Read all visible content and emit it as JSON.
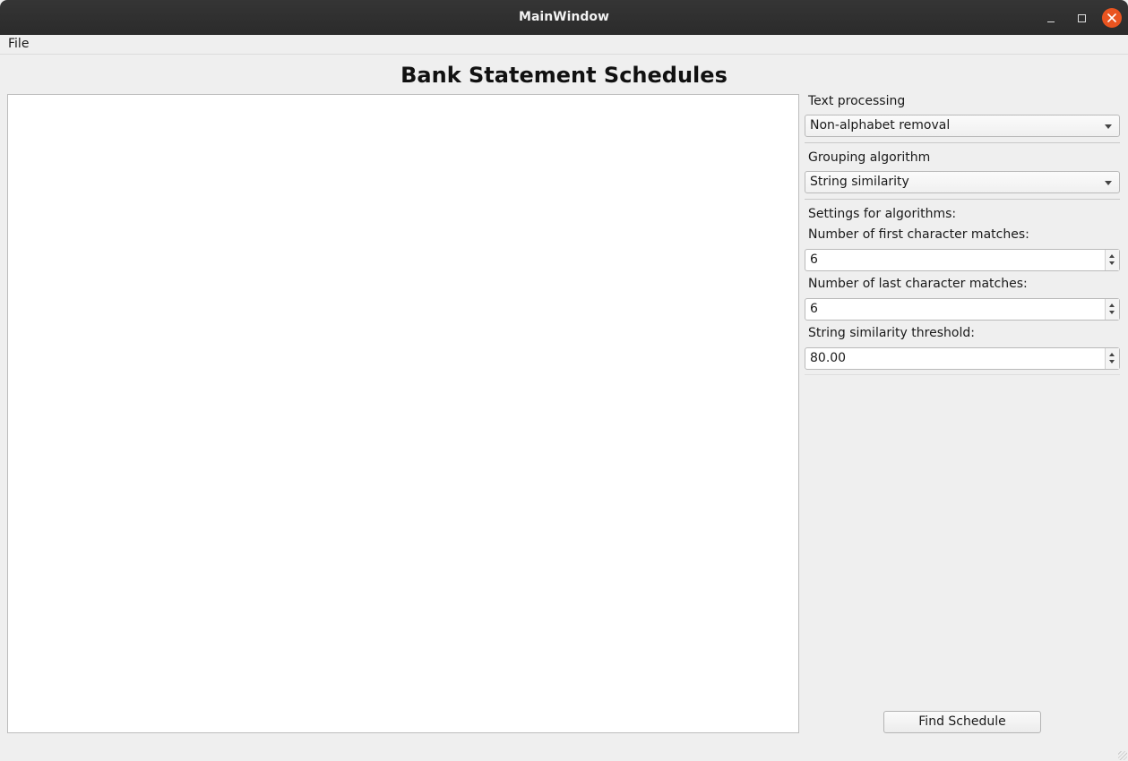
{
  "window": {
    "title": "MainWindow",
    "controls": [
      "minimize-icon",
      "maximize-icon",
      "close-icon"
    ],
    "close_color": "#e95420"
  },
  "menubar": {
    "items": [
      {
        "label": "File"
      }
    ]
  },
  "heading": "Bank Statement Schedules",
  "controls": {
    "text_processing": {
      "label": "Text processing",
      "value": "Non-alphabet removal"
    },
    "grouping_algorithm": {
      "label": "Grouping algorithm",
      "value": "String similarity"
    },
    "settings_header": "Settings for algorithms:",
    "first_char_matches": {
      "label": "Number of first character matches:",
      "value": "6"
    },
    "last_char_matches": {
      "label": "Number of last character matches:",
      "value": "6"
    },
    "similarity_threshold": {
      "label": "String similarity threshold:",
      "value": "80.00"
    }
  },
  "actions": {
    "find_schedule": "Find Schedule"
  }
}
